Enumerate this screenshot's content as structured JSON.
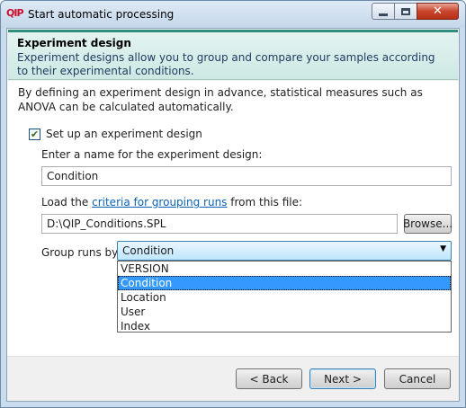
{
  "window": {
    "app_logo_text": "QIP",
    "title": "Start automatic processing",
    "controls": {
      "minimize": "minimize",
      "maximize": "maximize",
      "close": "✕"
    }
  },
  "header": {
    "title": "Experiment design",
    "description": "Experiment designs allow you to group and compare your samples according to their experimental conditions."
  },
  "content": {
    "intro": "By defining an experiment design in advance, statistical measures such as ANOVA can be calculated automatically.",
    "setup_checkbox": {
      "label": "Set up an experiment design",
      "checked": true
    },
    "name_label": "Enter a name for the experiment design:",
    "name_value": "Condition",
    "load_label_prefix": "Load the ",
    "load_label_link": "criteria for grouping runs",
    "load_label_suffix": " from this file:",
    "file_value": "D:\\QIP_Conditions.SPL",
    "browse_label": "Browse...",
    "group_label": "Group runs by:",
    "group_selected": "Condition",
    "group_options": [
      "VERSION",
      "Condition",
      "Location",
      "User",
      "Index"
    ]
  },
  "footer": {
    "back_label": "< Back",
    "next_label": "Next >",
    "cancel_label": "Cancel"
  },
  "colors": {
    "header_accent": "#2e8f7e",
    "selection": "#3399ff",
    "link": "#0a61b5"
  }
}
